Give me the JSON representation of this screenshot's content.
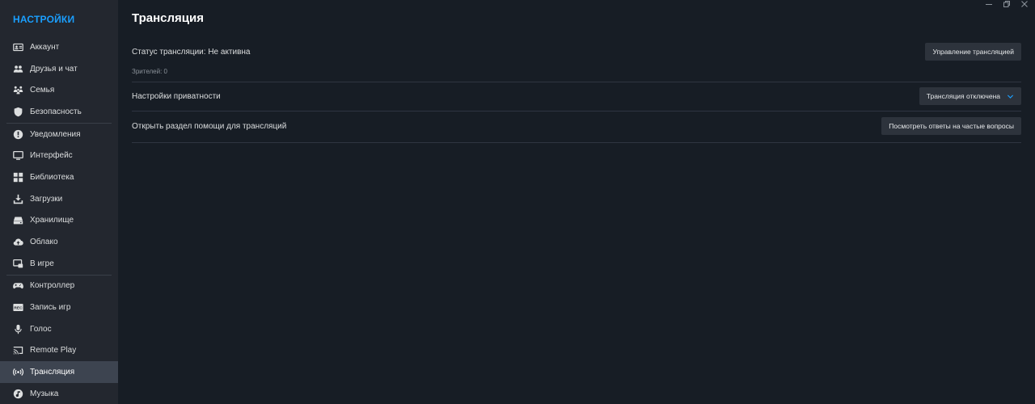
{
  "sidebar": {
    "title": "НАСТРОЙКИ",
    "items": [
      {
        "label": "Аккаунт",
        "icon": "account-card-icon"
      },
      {
        "label": "Друзья и чат",
        "icon": "friends-icon"
      },
      {
        "label": "Семья",
        "icon": "family-icon"
      },
      {
        "label": "Безопасность",
        "icon": "shield-icon"
      },
      {
        "label": "Уведомления",
        "icon": "notification-icon"
      },
      {
        "label": "Интерфейс",
        "icon": "monitor-icon"
      },
      {
        "label": "Библиотека",
        "icon": "grid-icon"
      },
      {
        "label": "Загрузки",
        "icon": "download-icon"
      },
      {
        "label": "Хранилище",
        "icon": "storage-icon"
      },
      {
        "label": "Облако",
        "icon": "cloud-icon"
      },
      {
        "label": "В игре",
        "icon": "in-game-icon"
      },
      {
        "label": "Контроллер",
        "icon": "controller-icon"
      },
      {
        "label": "Запись игр",
        "icon": "rec-icon"
      },
      {
        "label": "Голос",
        "icon": "microphone-icon"
      },
      {
        "label": "Remote Play",
        "icon": "cast-icon"
      },
      {
        "label": "Трансляция",
        "icon": "broadcast-icon",
        "active": true
      },
      {
        "label": "Музыка",
        "icon": "music-icon"
      }
    ]
  },
  "main": {
    "title": "Трансляция",
    "status": {
      "label": "Статус трансляции: Не активна",
      "viewers": "Зрителей: 0",
      "button": "Управление трансляцией"
    },
    "privacy": {
      "label": "Настройки приватности",
      "select_value": "Трансляция отключена"
    },
    "help": {
      "label": "Открыть раздел помощи для трансляций",
      "button": "Посмотреть ответы на частые вопросы"
    }
  },
  "colors": {
    "accent": "#1a9fff",
    "sidebar_bg": "#23272f",
    "main_bg": "#171d25",
    "active_item_bg": "#3d4450",
    "button_bg": "#2d333c"
  }
}
